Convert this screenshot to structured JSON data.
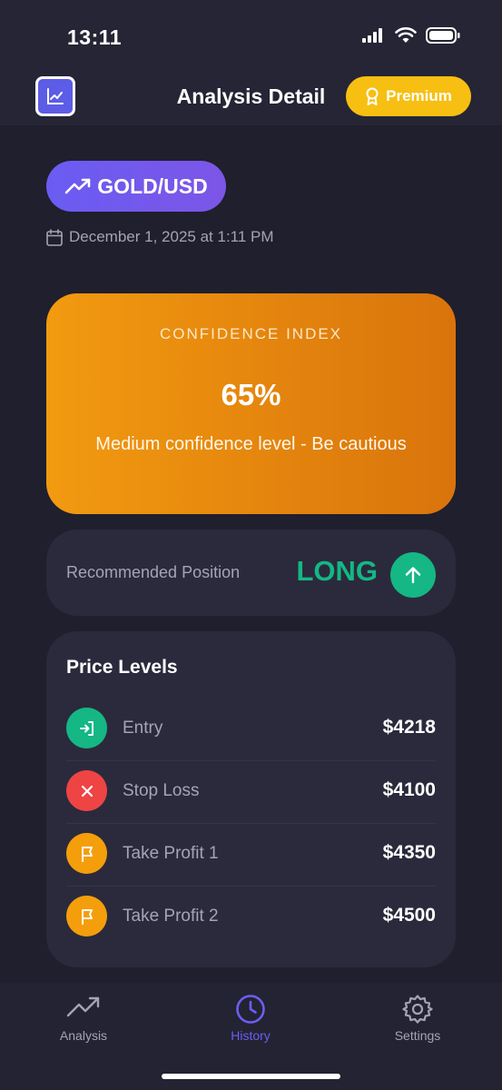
{
  "status_bar": {
    "time": "13:11"
  },
  "header": {
    "title": "Analysis Detail",
    "premium_label": "Premium"
  },
  "analysis": {
    "pair": "GOLD/USD",
    "date": "December 1, 2025 at 1:11 PM"
  },
  "confidence": {
    "label": "CONFIDENCE INDEX",
    "value": "65%",
    "description": "Medium confidence level - Be cautious"
  },
  "position": {
    "label": "Recommended Position",
    "value": "LONG"
  },
  "price_levels": {
    "title": "Price Levels",
    "items": [
      {
        "label": "Entry",
        "value": "$4218",
        "icon": "entry-icon",
        "color": "#15b784"
      },
      {
        "label": "Stop Loss",
        "value": "$4100",
        "icon": "close-icon",
        "color": "#ee4444"
      },
      {
        "label": "Take Profit 1",
        "value": "$4350",
        "icon": "flag-icon",
        "color": "#f59e0b"
      },
      {
        "label": "Take Profit 2",
        "value": "$4500",
        "icon": "flag-icon",
        "color": "#f59e0b"
      }
    ]
  },
  "tab_bar": {
    "tabs": [
      {
        "label": "Analysis",
        "icon": "trending-up-icon",
        "active": false
      },
      {
        "label": "History",
        "icon": "clock-icon",
        "active": true
      },
      {
        "label": "Settings",
        "icon": "gear-icon",
        "active": false
      }
    ]
  },
  "colors": {
    "background": "#1f1f2d",
    "accent": "#6b5ff0",
    "premium": "#f7bf12",
    "confidence_gradient": [
      "#f29a10",
      "#d9740c"
    ],
    "long": "#14b784"
  }
}
